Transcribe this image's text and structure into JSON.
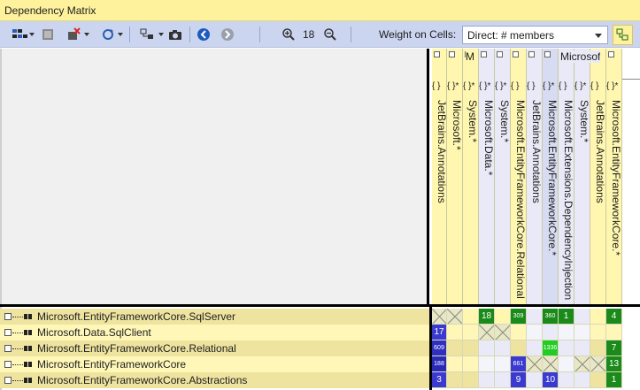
{
  "window": {
    "title": "Dependency Matrix"
  },
  "toolbar": {
    "zoom_value": "18",
    "weight_label": "Weight on Cells:",
    "weight_selected": "Direct: # members",
    "icons": [
      "matrix-view-icon",
      "delete-element-icon",
      "delete-all-icon",
      "refresh-icon",
      "group-icon",
      "camera-icon",
      "back-icon",
      "forward-icon",
      "zoom-in-icon",
      "zoom-out-icon",
      "layout-icon"
    ]
  },
  "header_groups": [
    {
      "label": "M"
    },
    {
      "label": "Microsof"
    }
  ],
  "columns": [
    {
      "label": "JetBrains.Annotations",
      "braces": "{ }",
      "color": "#fff7b0"
    },
    {
      "label": "Microsoft.*",
      "braces": "{ }*",
      "color": "#fff7b0"
    },
    {
      "label": "System.*",
      "braces": "{ }*",
      "color": "#fff7b0"
    },
    {
      "label": "Microsoft.Data.*",
      "braces": "{ }*",
      "color": "#e9e9f7"
    },
    {
      "label": "System.*",
      "braces": "{ }*",
      "color": "#e9e9f7"
    },
    {
      "label": "Microsoft.EntityFrameworkCore.Relational",
      "braces": "{ }",
      "color": "#fff7b0"
    },
    {
      "label": "JetBrains.Annotations",
      "braces": "{ }",
      "color": "#e9e9f7"
    },
    {
      "label": "Microsoft.EntityFrameworkCore.*",
      "braces": "{ }*",
      "color": "#d8dcf2"
    },
    {
      "label": "Microsoft.Extensions.DependencyInjection",
      "braces": "{ }",
      "color": "#e9e9f7"
    },
    {
      "label": "System.*",
      "braces": "{ }*",
      "color": "#e9e9f7"
    },
    {
      "label": "JetBrains.Annotations",
      "braces": "{ }",
      "color": "#fff7b0"
    },
    {
      "label": "Microsoft.EntityFrameworkCore.*",
      "braces": "{ }*",
      "color": "#fff7b0"
    }
  ],
  "rows": [
    {
      "label": "Microsoft.EntityFrameworkCore.SqlServer",
      "color": "#eee4a0"
    },
    {
      "label": "Microsoft.Data.SqlClient",
      "color": "#fff7b8"
    },
    {
      "label": "Microsoft.EntityFrameworkCore.Relational",
      "color": "#eee4a0"
    },
    {
      "label": "Microsoft.EntityFrameworkCore",
      "color": "#fff7b8"
    },
    {
      "label": "Microsoft.EntityFrameworkCore.Abstractions",
      "color": "#eee4a0"
    }
  ],
  "cells": [
    [
      "x",
      "x",
      "",
      "18",
      "",
      "309",
      "",
      "360",
      "1",
      "",
      "",
      "4"
    ],
    [
      "17",
      "",
      "",
      "x",
      "x",
      "",
      "",
      "",
      "",
      "",
      "",
      ""
    ],
    [
      "609",
      "",
      "",
      "",
      "",
      "",
      "",
      "1336",
      "",
      "",
      "",
      "7"
    ],
    [
      "188",
      "",
      "",
      "",
      "",
      "661",
      "x",
      "x",
      "",
      "x",
      "x",
      "13"
    ],
    [
      "3",
      "",
      "",
      "",
      "",
      "9",
      "",
      "10",
      "",
      "",
      "",
      "1"
    ]
  ],
  "cell_colors": [
    [
      "#e8e8c8",
      "#e8e8c8",
      "#fff7b0",
      "#1a8a1a",
      "#fff7b0",
      "#1a8a1a",
      "#e9e9f7",
      "#1a8a1a",
      "#1a8a1a",
      "#e9e9f7",
      "#fff7b0",
      "#1a8a1a"
    ],
    [
      "#3a3ad0",
      "#fff7b8",
      "#fff7b8",
      "#e8e8c8",
      "#e8e8c8",
      "#fff7b8",
      "#f4f4fb",
      "#e9ecf8",
      "#f4f4fb",
      "#f4f4fb",
      "#fff7b8",
      "#fff7b8"
    ],
    [
      "#2f2fc0",
      "#eee4a0",
      "#eee4a0",
      "#e9e9f7",
      "#e9e9f7",
      "#eee4a0",
      "#e9e9f7",
      "#22cc22",
      "#e9e9f7",
      "#e9e9f7",
      "#eee4a0",
      "#1a8a1a"
    ],
    [
      "#2a2ab8",
      "#fff7b8",
      "#fff7b8",
      "#f4f4fb",
      "#f4f4fb",
      "#3a3ad0",
      "#e8e8c8",
      "#e8e8c8",
      "#f4f4fb",
      "#e8e8c8",
      "#e8e8c8",
      "#1a8a1a"
    ],
    [
      "#3a3ad0",
      "#eee4a0",
      "#eee4a0",
      "#e9e9f7",
      "#e9e9f7",
      "#3a3ad0",
      "#e9e9f7",
      "#3a3ad0",
      "#e9e9f7",
      "#e9e9f7",
      "#eee4a0",
      "#1a8a1a"
    ]
  ]
}
